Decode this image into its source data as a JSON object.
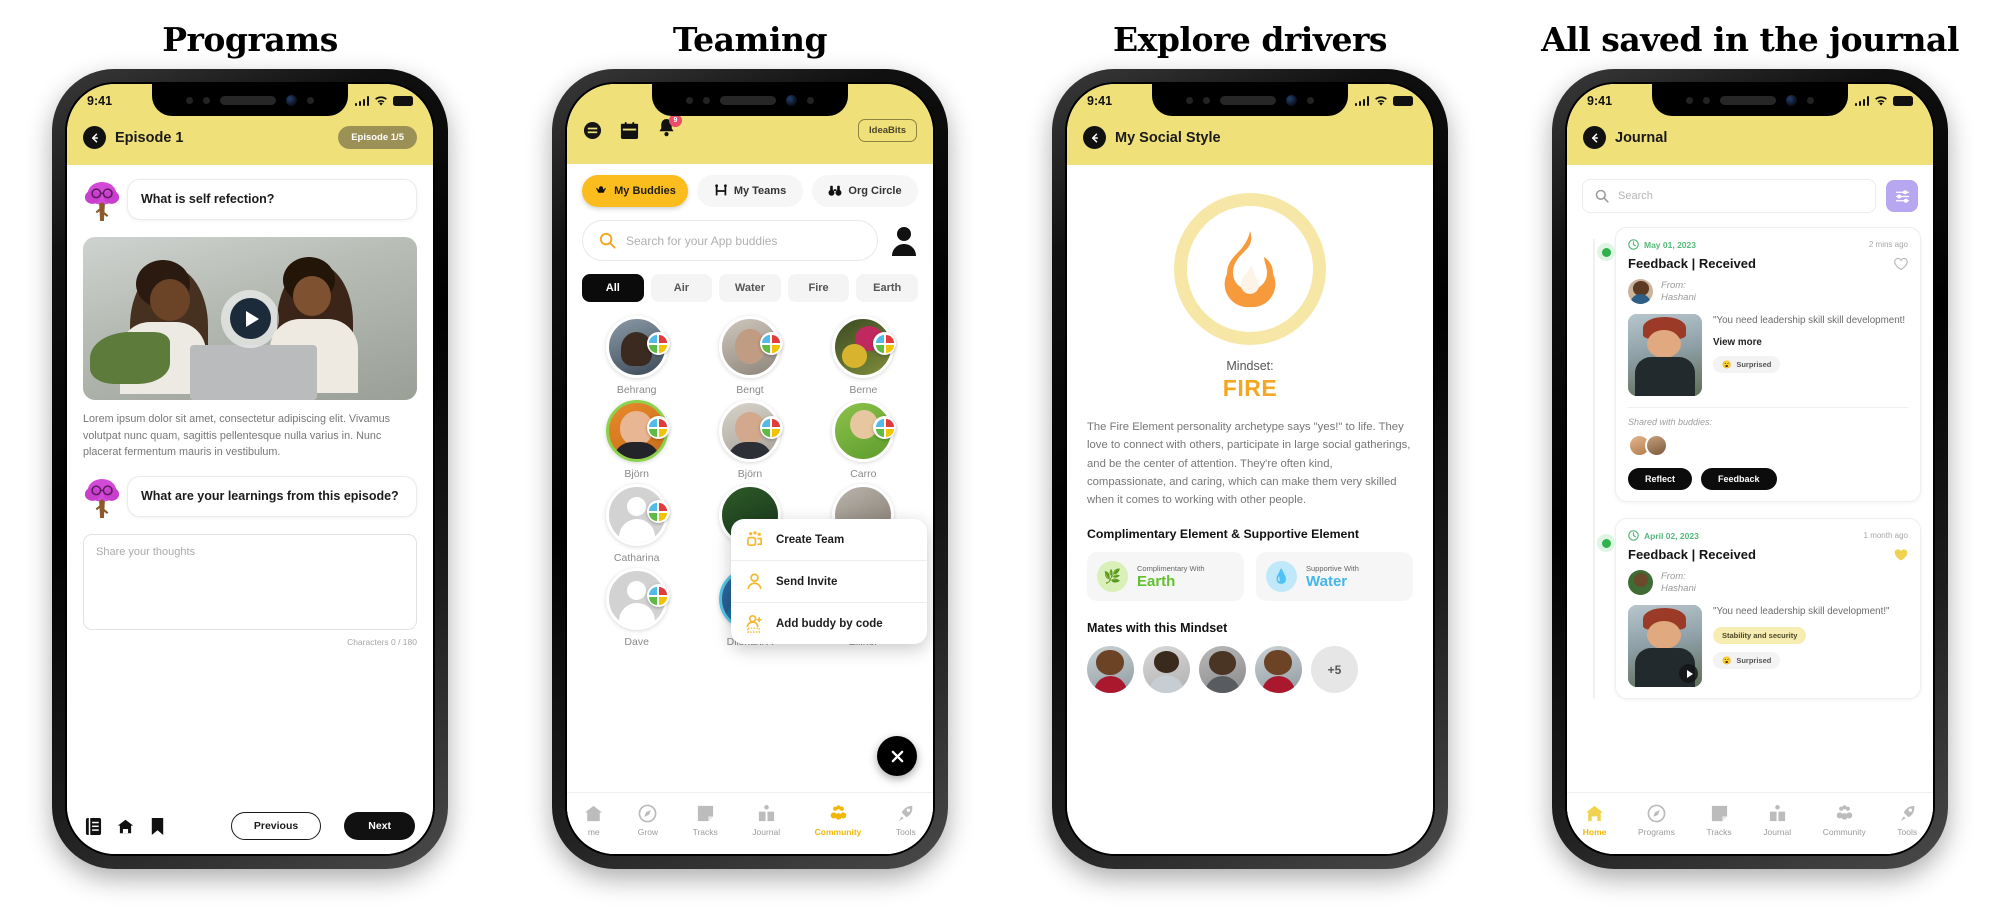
{
  "columns": [
    {
      "caption": "Programs"
    },
    {
      "caption": "Teaming"
    },
    {
      "caption": "Explore drivers"
    },
    {
      "caption": "All saved in the journal"
    }
  ],
  "status_bar": {
    "time": "9:41"
  },
  "phone1": {
    "header": {
      "title": "Episode 1",
      "badge": "Episode 1/5"
    },
    "question1": "What is self refection?",
    "lorem": "Lorem ipsum dolor sit amet, consectetur adipiscing elit. Vivamus volutpat nunc quam, sagittis pellentesque nulla varius in. Nunc placerat fermentum mauris in vestibulum.",
    "question2": "What are your learnings from this episode?",
    "textarea_placeholder": "Share your thoughts",
    "char_count": "Characters 0 / 180",
    "footer_icons": [
      "notebook-icon",
      "home-icon",
      "bookmark-icon"
    ],
    "prev_label": "Previous",
    "next_label": "Next"
  },
  "phone2": {
    "top_icons": [
      "menu-icon",
      "calendar-icon",
      "bell-icon"
    ],
    "bell_badge": "9",
    "ideabits_label": "IdeaBits",
    "segments": [
      {
        "label": "My Buddies",
        "icon": "buddy-icon",
        "active": true
      },
      {
        "label": "My Teams",
        "icon": "team-icon",
        "active": false
      },
      {
        "label": "Org Circle",
        "icon": "binoculars-icon",
        "active": false
      }
    ],
    "search_placeholder": "Search for your App buddies",
    "chips": [
      {
        "label": "All",
        "active": true
      },
      {
        "label": "Air",
        "active": false
      },
      {
        "label": "Water",
        "active": false
      },
      {
        "label": "Fire",
        "active": false
      },
      {
        "label": "Earth",
        "active": false
      }
    ],
    "buddies": [
      {
        "name": "Behrang",
        "ring": "none",
        "kind": "photo"
      },
      {
        "name": "Bengt",
        "ring": "none",
        "kind": "photo"
      },
      {
        "name": "Berne",
        "ring": "none",
        "kind": "photo"
      },
      {
        "name": "Björn",
        "ring": "green",
        "kind": "photo"
      },
      {
        "name": "Björn",
        "ring": "none",
        "kind": "photo"
      },
      {
        "name": "Carro",
        "ring": "none",
        "kind": "photo"
      },
      {
        "name": "Catharina",
        "ring": "none",
        "kind": "placeholder"
      },
      {
        "name": "",
        "ring": "none",
        "kind": "photo"
      },
      {
        "name": "",
        "ring": "none",
        "kind": "photo"
      },
      {
        "name": "Dave",
        "ring": "none",
        "kind": "placeholder"
      },
      {
        "name": "Dilshani A",
        "ring": "blue",
        "kind": "photo"
      },
      {
        "name": "Ellinor",
        "ring": "none",
        "kind": "photo"
      }
    ],
    "popup_menu": [
      {
        "label": "Create Team",
        "icon": "create-team-icon"
      },
      {
        "label": "Send Invite",
        "icon": "send-invite-icon"
      },
      {
        "label": "Add buddy by code",
        "icon": "add-buddy-code-icon"
      }
    ],
    "fab_icon": "close-icon",
    "tabs": [
      {
        "label": "me",
        "icon": "home-icon",
        "active": false
      },
      {
        "label": "Grow",
        "icon": "compass-icon",
        "active": false
      },
      {
        "label": "Tracks",
        "icon": "note-icon",
        "active": false
      },
      {
        "label": "Journal",
        "icon": "book-icon",
        "active": false
      },
      {
        "label": "Community",
        "icon": "community-icon",
        "active": true
      },
      {
        "label": "Tools",
        "icon": "rocket-icon",
        "active": false
      }
    ]
  },
  "phone3": {
    "header": {
      "title": "My Social Style"
    },
    "mindset_label": "Mindset:",
    "mindset_value": "FIRE",
    "description": "The Fire Element personality archetype says \"yes!\" to life. They love to connect with others, participate in large social gatherings, and be the center of attention. They're often kind, compassionate, and caring, which can make them very skilled when it comes to working with other people.",
    "elements_heading": "Complimentary Element & Supportive Element",
    "elements": [
      {
        "kicker": "Complimentary With",
        "name": "Earth",
        "icon": "earth-icon",
        "color": "#62c12e"
      },
      {
        "kicker": "Supportive With",
        "name": "Water",
        "icon": "water-icon",
        "color": "#45b6e8"
      }
    ],
    "mates_heading": "Mates with this Mindset",
    "mates_more": "+5",
    "mates_count": 4
  },
  "phone4": {
    "header": {
      "title": "Journal"
    },
    "search_placeholder": "Search",
    "filter_icon": "filter-icon",
    "entries": [
      {
        "date": "May 01, 2023",
        "ago": "2 mins ago",
        "title": "Feedback | Received",
        "from_label": "From:",
        "from_name": "Hashani",
        "quote": "\"You need leadership skill skill development!",
        "view_more": "View more",
        "tags": [
          {
            "label": "Surprised",
            "style": "grey",
            "emoji": "😮"
          }
        ],
        "shared_label": "Shared with buddies:",
        "shared_count": 2,
        "actions": [
          "Reflect",
          "Feedback"
        ],
        "liked": false,
        "has_video": false
      },
      {
        "date": "April 02, 2023",
        "ago": "1 month ago",
        "title": "Feedback | Received",
        "from_label": "From:",
        "from_name": "Hashani",
        "quote": "\"You need leadership skill development!\"",
        "view_more": "",
        "tags": [
          {
            "label": "Stability and security",
            "style": "yellow",
            "emoji": ""
          },
          {
            "label": "Surprised",
            "style": "grey",
            "emoji": "😮"
          }
        ],
        "shared_label": "",
        "shared_count": 0,
        "actions": [],
        "liked": true,
        "has_video": true
      }
    ],
    "tabs": [
      {
        "label": "Home",
        "icon": "home-icon",
        "active": true
      },
      {
        "label": "Programs",
        "icon": "compass-icon",
        "active": false
      },
      {
        "label": "Tracks",
        "icon": "note-icon",
        "active": false
      },
      {
        "label": "Journal",
        "icon": "book-icon",
        "active": false
      },
      {
        "label": "Community",
        "icon": "community-icon",
        "active": false
      },
      {
        "label": "Tools",
        "icon": "rocket-icon",
        "active": false
      }
    ]
  },
  "colors": {
    "header_yellow": "#f0e07a",
    "accent_yellow": "#fbbd1e",
    "fire_orange": "#f5a623",
    "earth_green": "#62c12e",
    "water_blue": "#45b6e8",
    "purple_filter": "#b7a6f0"
  }
}
